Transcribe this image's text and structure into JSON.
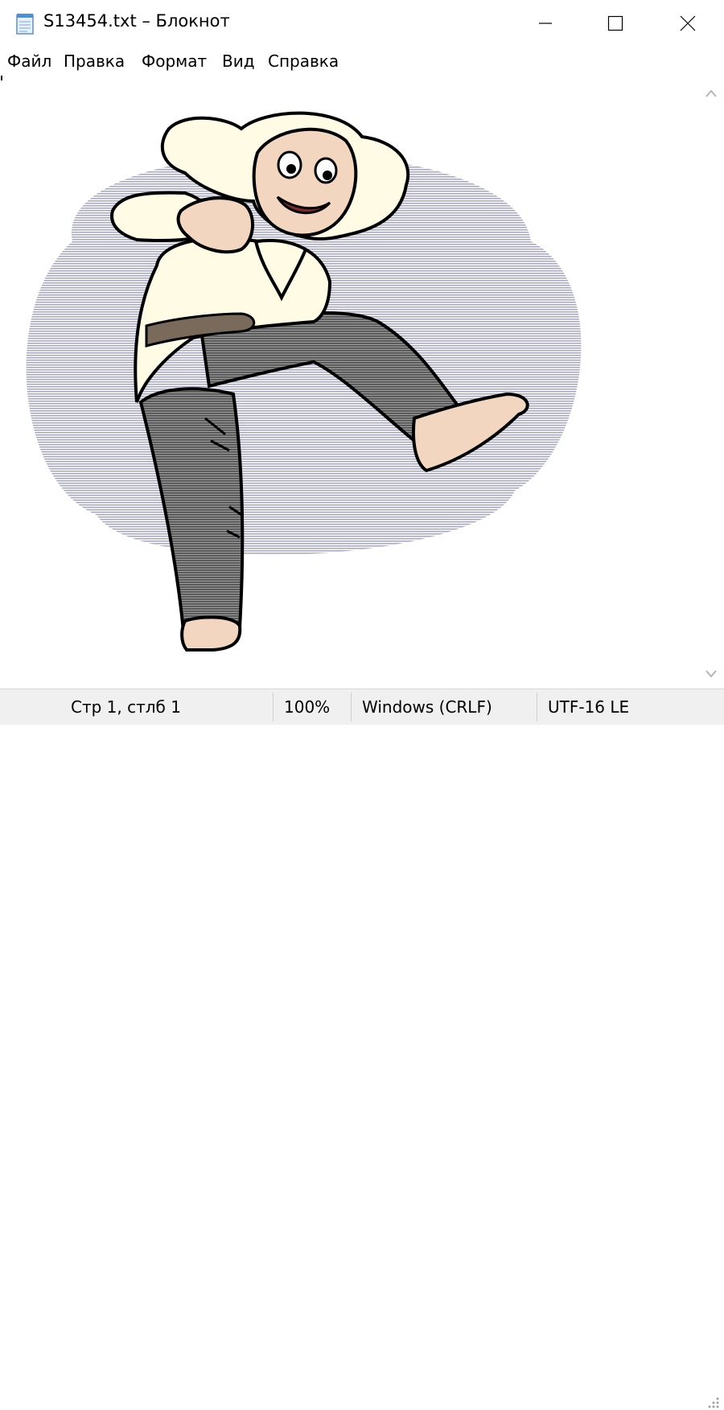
{
  "window": {
    "title": "S13454.txt – Блокнот",
    "minimize_icon": "minimize-icon",
    "maximize_icon": "maximize-icon",
    "close_icon": "close-icon"
  },
  "menu": {
    "items": [
      {
        "label": "Файл"
      },
      {
        "label": "Правка"
      },
      {
        "label": "Формат"
      },
      {
        "label": "Вид"
      },
      {
        "label": "Справка"
      }
    ]
  },
  "statusbar": {
    "position": "Стр 1, стлб 1",
    "zoom": "100%",
    "line_endings": "Windows (CRLF)",
    "encoding": "UTF-16 LE"
  },
  "colors": {
    "oval": "#a9a9c8",
    "skin": "#f2d6c0",
    "hair": "#fffbe4",
    "pants": "#6b6b6b",
    "belt": "#7a6a5c",
    "status_bg": "#f0f0f0"
  }
}
